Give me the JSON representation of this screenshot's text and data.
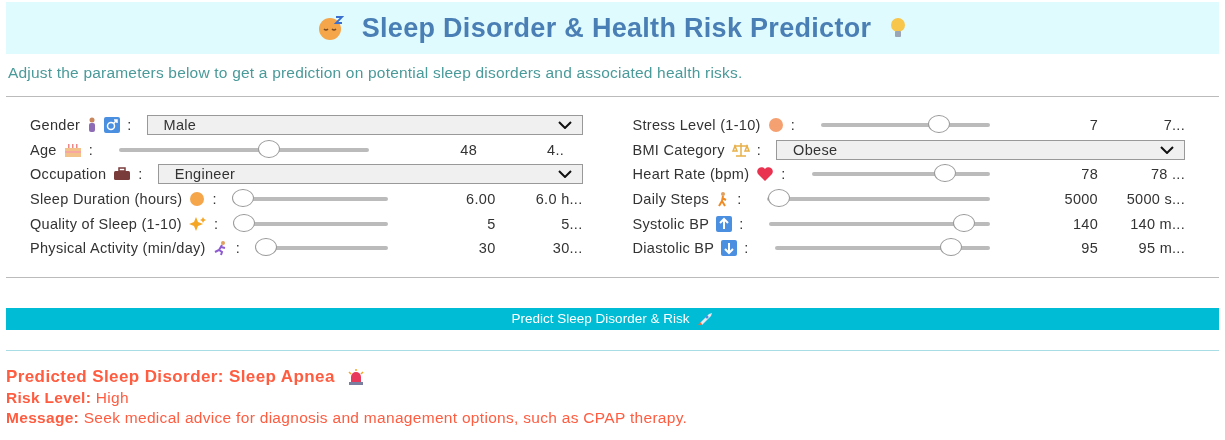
{
  "header": {
    "title": "Sleep Disorder & Health Risk Predictor"
  },
  "intro": "Adjust the parameters below to get a prediction on potential sleep disorders and associated health risks.",
  "columns": [
    {
      "fields": [
        {
          "kind": "select",
          "label": "Gender",
          "colon": ":",
          "value": "Male"
        },
        {
          "kind": "slider",
          "label": "Age",
          "colon": ":",
          "level": 0.6,
          "value": "48",
          "readout": "4.."
        },
        {
          "kind": "select",
          "label": "Occupation",
          "colon": ":",
          "value": "Engineer"
        },
        {
          "kind": "slider",
          "label": "Sleep Duration (hours)",
          "colon": ":",
          "level": 0,
          "value": "6.00",
          "readout": "6.0 h..."
        },
        {
          "kind": "slider",
          "label": "Quality of Sleep (1-10)",
          "colon": ":",
          "level": 0,
          "value": "5",
          "readout": "5..."
        },
        {
          "kind": "slider",
          "label": "Physical Activity (min/day)",
          "colon": ":",
          "level": 0,
          "value": "30",
          "readout": "30..."
        }
      ]
    },
    {
      "fields": [
        {
          "kind": "slider",
          "label": "Stress Level (1-10)",
          "colon": ":",
          "level": 0.7,
          "value": "7",
          "readout": "7..."
        },
        {
          "kind": "select",
          "label": "BMI Category",
          "colon": ":",
          "value": "Obese"
        },
        {
          "kind": "slider",
          "label": "Heart Rate (bpm)",
          "colon": ":",
          "level": 0.75,
          "value": "78",
          "readout": "78 ..."
        },
        {
          "kind": "slider",
          "label": "Daily Steps",
          "colon": ":",
          "level": 0.05,
          "value": "5000",
          "readout": "5000 s..."
        },
        {
          "kind": "slider",
          "label": "Systolic BP",
          "colon": ":",
          "level": 0.88,
          "value": "140",
          "readout": "140 m..."
        },
        {
          "kind": "slider",
          "label": "Diastolic BP",
          "colon": ":",
          "level": 0.82,
          "value": "95",
          "readout": "95 m..."
        }
      ]
    }
  ],
  "button": "Predict Sleep Disorder & Risk",
  "result": {
    "heading": "Predicted Sleep Disorder: Sleep Apnea",
    "lines": [
      "**Risk Level:** High",
      "**Message:** Seek medical advice for diagnosis and management options, such as CPAP therapy."
    ]
  }
}
